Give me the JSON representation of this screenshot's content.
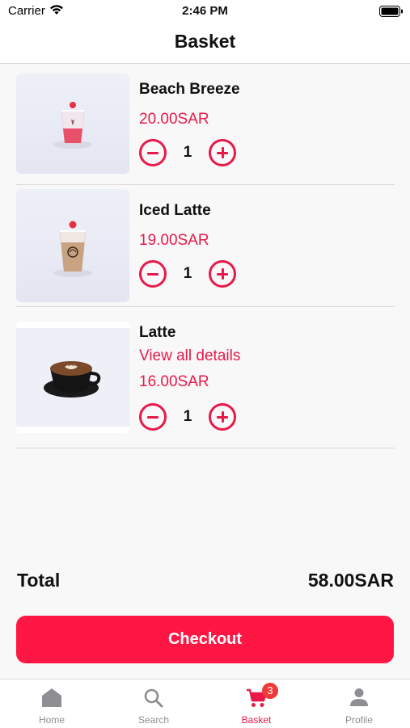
{
  "status_bar": {
    "carrier": "Carrier",
    "time": "2:46 PM"
  },
  "header": {
    "title": "Basket"
  },
  "items": [
    {
      "name": "Beach Breeze",
      "price": "20.00SAR",
      "quantity": "1",
      "image_icon": "beach-breeze-drink-image"
    },
    {
      "name": "Iced Latte",
      "price": "19.00SAR",
      "quantity": "1",
      "image_icon": "iced-latte-drink-image"
    },
    {
      "name": "Latte",
      "details_link": "View all details",
      "price": "16.00SAR",
      "quantity": "1",
      "image_icon": "latte-cup-image"
    }
  ],
  "summary": {
    "total_label": "Total",
    "total_value": "58.00SAR"
  },
  "checkout": {
    "label": "Checkout"
  },
  "tabbar": {
    "tabs": [
      {
        "label": "Home",
        "icon": "home-icon"
      },
      {
        "label": "Search",
        "icon": "search-icon"
      },
      {
        "label": "Basket",
        "icon": "cart-icon",
        "badge": "3",
        "active": true
      },
      {
        "label": "Profile",
        "icon": "profile-icon"
      }
    ]
  },
  "colors": {
    "accent": "#e8194a",
    "checkout_bg": "#ff1744",
    "badge": "#f03a3a"
  }
}
